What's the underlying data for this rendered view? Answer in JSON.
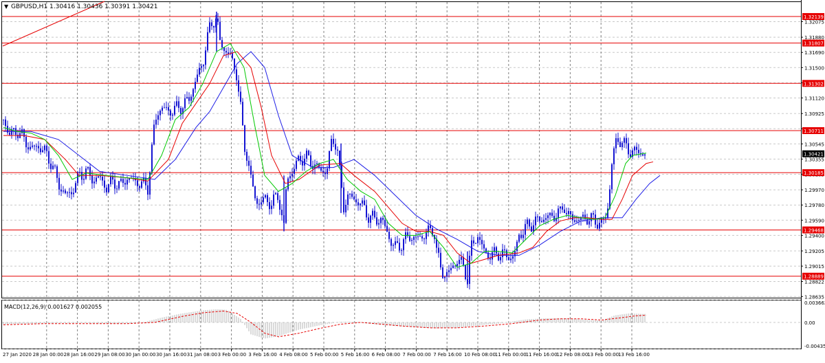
{
  "header": {
    "menu_arrow": "▼",
    "symbol_line": "GBPUSD,H1  1.30416 1.30436 1.30391 1.30421"
  },
  "colors": {
    "background": "#ffffff",
    "grid": "#c8c8c8",
    "candle": "#1414d2",
    "ma_fast": "#00c800",
    "ma_mid": "#e60000",
    "ma_slow": "#1e1ee6",
    "level_line": "#e60000",
    "level_label_bg": "#e60000",
    "current_label_bg": "#000000",
    "macd_hist": "#b4b4b4",
    "macd_signal": "#e60000"
  },
  "price_axis": {
    "ticks": [
      "1.32075",
      "1.31880",
      "1.31690",
      "1.31500",
      "1.31310",
      "1.31120",
      "1.30925",
      "1.30735",
      "1.30545",
      "1.30355",
      "1.30165",
      "1.29970",
      "1.29780",
      "1.29590",
      "1.29400",
      "1.29205",
      "1.29015",
      "1.28822",
      "1.28635"
    ],
    "price_range": [
      1.2862,
      1.3232
    ]
  },
  "levels": [
    "1.32139",
    "1.31807",
    "1.31302",
    "1.30711",
    "1.30185",
    "1.29468",
    "1.28889"
  ],
  "current_price": "1.30421",
  "macd": {
    "title": "MACD(12,26,9) 0.001627 0.002055",
    "ticks": [
      "0.003662",
      "0.00",
      "-0.004358"
    ],
    "value_range": [
      -0.004358,
      0.003662
    ]
  },
  "time_axis": [
    "27 Jan 2020",
    "28 Jan 00:00",
    "28 Jan 16:00",
    "29 Jan 08:00",
    "30 Jan 00:00",
    "30 Jan 16:00",
    "31 Jan 08:00",
    "3 Feb 00:00",
    "3 Feb 16:00",
    "4 Feb 08:00",
    "5 Feb 00:00",
    "5 Feb 16:00",
    "6 Feb 08:00",
    "7 Feb 00:00",
    "7 Feb 16:00",
    "10 Feb 08:00",
    "11 Feb 00:00",
    "11 Feb 16:00",
    "12 Feb 08:00",
    "13 Feb 00:00",
    "13 Feb 16:00"
  ],
  "chart_data": {
    "type": "candlestick",
    "symbol": "GBPUSD",
    "timeframe": "H1",
    "close_path": [
      [
        0,
        1.3085
      ],
      [
        10,
        1.3065
      ],
      [
        20,
        1.3072
      ],
      [
        30,
        1.306
      ],
      [
        40,
        1.3048
      ],
      [
        50,
        1.3052
      ],
      [
        60,
        1.3045
      ],
      [
        70,
        1.303
      ],
      [
        80,
        1.3005
      ],
      [
        90,
        1.299
      ],
      [
        100,
        1.2995
      ],
      [
        110,
        1.3015
      ],
      [
        120,
        1.302
      ],
      [
        130,
        1.301
      ],
      [
        140,
        1.3012
      ],
      [
        150,
        1.3
      ],
      [
        160,
        1.3008
      ],
      [
        170,
        1.3002
      ],
      [
        180,
        1.3012
      ],
      [
        190,
        1.3008
      ],
      [
        200,
        1.3005
      ],
      [
        210,
        1.3
      ],
      [
        215,
        1.304
      ],
      [
        220,
        1.308
      ],
      [
        225,
        1.3095
      ],
      [
        230,
        1.31
      ],
      [
        240,
        1.3095
      ],
      [
        250,
        1.3098
      ],
      [
        260,
        1.3102
      ],
      [
        270,
        1.311
      ],
      [
        280,
        1.3135
      ],
      [
        285,
        1.3145
      ],
      [
        290,
        1.3155
      ],
      [
        295,
        1.3182
      ],
      [
        300,
        1.3198
      ],
      [
        305,
        1.3208
      ],
      [
        310,
        1.3215
      ],
      [
        315,
        1.318
      ],
      [
        320,
        1.3175
      ],
      [
        325,
        1.317
      ],
      [
        330,
        1.3165
      ],
      [
        335,
        1.315
      ],
      [
        340,
        1.314
      ],
      [
        345,
        1.31
      ],
      [
        350,
        1.305
      ],
      [
        355,
        1.304
      ],
      [
        360,
        1.301
      ],
      [
        365,
        1.299
      ],
      [
        370,
        1.298
      ],
      [
        380,
        1.2985
      ],
      [
        390,
        1.298
      ],
      [
        400,
        1.299
      ],
      [
        408,
        1.295
      ],
      [
        412,
        1.301
      ],
      [
        420,
        1.302
      ],
      [
        430,
        1.3035
      ],
      [
        440,
        1.3038
      ],
      [
        450,
        1.303
      ],
      [
        460,
        1.3022
      ],
      [
        470,
        1.302
      ],
      [
        478,
        1.306
      ],
      [
        485,
        1.3055
      ],
      [
        490,
        1.301
      ],
      [
        495,
        1.2975
      ],
      [
        500,
        1.299
      ],
      [
        510,
        1.2985
      ],
      [
        520,
        1.298
      ],
      [
        530,
        1.2965
      ],
      [
        540,
        1.296
      ],
      [
        550,
        1.296
      ],
      [
        560,
        1.294
      ],
      [
        565,
        1.293
      ],
      [
        570,
        1.2925
      ],
      [
        580,
        1.293
      ],
      [
        590,
        1.294
      ],
      [
        600,
        1.2935
      ],
      [
        610,
        1.294
      ],
      [
        620,
        1.2945
      ],
      [
        626,
        1.295
      ],
      [
        630,
        1.292
      ],
      [
        636,
        1.29
      ],
      [
        640,
        1.289
      ],
      [
        650,
        1.2895
      ],
      [
        660,
        1.291
      ],
      [
        670,
        1.29
      ],
      [
        675,
        1.2885
      ],
      [
        680,
        1.2925
      ],
      [
        690,
        1.294
      ],
      [
        700,
        1.2918
      ],
      [
        710,
        1.2915
      ],
      [
        720,
        1.2918
      ],
      [
        730,
        1.2915
      ],
      [
        740,
        1.2912
      ],
      [
        745,
        1.292
      ],
      [
        750,
        1.294
      ],
      [
        760,
        1.295
      ],
      [
        770,
        1.2955
      ],
      [
        780,
        1.296
      ],
      [
        790,
        1.2962
      ],
      [
        800,
        1.2965
      ],
      [
        810,
        1.2968
      ],
      [
        815,
        1.298
      ],
      [
        820,
        1.2965
      ],
      [
        830,
        1.296
      ],
      [
        840,
        1.296
      ],
      [
        850,
        1.2962
      ],
      [
        860,
        1.2958
      ],
      [
        870,
        1.2955
      ],
      [
        875,
        1.296
      ],
      [
        880,
        1.298
      ],
      [
        885,
        1.303
      ],
      [
        890,
        1.3055
      ],
      [
        895,
        1.306
      ],
      [
        900,
        1.3058
      ],
      [
        905,
        1.305
      ],
      [
        910,
        1.3046
      ],
      [
        920,
        1.3045
      ],
      [
        930,
        1.3043
      ],
      [
        935,
        1.3042
      ]
    ],
    "ma_fast": [
      [
        0,
        1.3075
      ],
      [
        20,
        1.307
      ],
      [
        40,
        1.3068
      ],
      [
        60,
        1.306
      ],
      [
        80,
        1.304
      ],
      [
        100,
        1.301
      ],
      [
        120,
        1.3018
      ],
      [
        150,
        1.3015
      ],
      [
        180,
        1.3012
      ],
      [
        210,
        1.301
      ],
      [
        230,
        1.304
      ],
      [
        250,
        1.3085
      ],
      [
        270,
        1.31
      ],
      [
        290,
        1.313
      ],
      [
        310,
        1.317
      ],
      [
        330,
        1.318
      ],
      [
        350,
        1.315
      ],
      [
        365,
        1.308
      ],
      [
        380,
        1.3015
      ],
      [
        400,
        1.2995
      ],
      [
        420,
        1.3005
      ],
      [
        440,
        1.302
      ],
      [
        460,
        1.303
      ],
      [
        480,
        1.3035
      ],
      [
        500,
        1.301
      ],
      [
        520,
        1.2995
      ],
      [
        540,
        1.2985
      ],
      [
        560,
        1.2955
      ],
      [
        580,
        1.294
      ],
      [
        600,
        1.294
      ],
      [
        620,
        1.2945
      ],
      [
        640,
        1.2925
      ],
      [
        660,
        1.29
      ],
      [
        680,
        1.2905
      ],
      [
        700,
        1.292
      ],
      [
        720,
        1.292
      ],
      [
        740,
        1.2918
      ],
      [
        760,
        1.2935
      ],
      [
        780,
        1.2952
      ],
      [
        800,
        1.296
      ],
      [
        820,
        1.2965
      ],
      [
        840,
        1.2962
      ],
      [
        860,
        1.296
      ],
      [
        875,
        1.2962
      ],
      [
        890,
        1.299
      ],
      [
        905,
        1.303
      ],
      [
        915,
        1.304
      ],
      [
        935,
        1.3043
      ]
    ],
    "ma_mid": [
      [
        0,
        1.3065
      ],
      [
        30,
        1.3065
      ],
      [
        60,
        1.306
      ],
      [
        90,
        1.3035
      ],
      [
        110,
        1.3015
      ],
      [
        140,
        1.3015
      ],
      [
        180,
        1.3012
      ],
      [
        210,
        1.3008
      ],
      [
        240,
        1.3035
      ],
      [
        260,
        1.308
      ],
      [
        280,
        1.3105
      ],
      [
        300,
        1.313
      ],
      [
        320,
        1.3165
      ],
      [
        340,
        1.317
      ],
      [
        360,
        1.315
      ],
      [
        375,
        1.31
      ],
      [
        390,
        1.304
      ],
      [
        410,
        1.3005
      ],
      [
        430,
        1.301
      ],
      [
        460,
        1.3028
      ],
      [
        490,
        1.303
      ],
      [
        510,
        1.3015
      ],
      [
        540,
        1.2995
      ],
      [
        560,
        1.2975
      ],
      [
        580,
        1.2955
      ],
      [
        600,
        1.2945
      ],
      [
        620,
        1.2945
      ],
      [
        640,
        1.294
      ],
      [
        660,
        1.2918
      ],
      [
        680,
        1.2905
      ],
      [
        700,
        1.291
      ],
      [
        720,
        1.2915
      ],
      [
        750,
        1.2918
      ],
      [
        770,
        1.2925
      ],
      [
        790,
        1.2945
      ],
      [
        810,
        1.2958
      ],
      [
        830,
        1.2962
      ],
      [
        850,
        1.2962
      ],
      [
        870,
        1.296
      ],
      [
        885,
        1.296
      ],
      [
        900,
        1.2985
      ],
      [
        915,
        1.3015
      ],
      [
        935,
        1.303
      ],
      [
        945,
        1.3032
      ]
    ],
    "ma_slow": [
      [
        0,
        1.307
      ],
      [
        40,
        1.307
      ],
      [
        80,
        1.306
      ],
      [
        110,
        1.304
      ],
      [
        140,
        1.302
      ],
      [
        180,
        1.3015
      ],
      [
        220,
        1.301
      ],
      [
        250,
        1.3035
      ],
      [
        280,
        1.3075
      ],
      [
        300,
        1.3095
      ],
      [
        320,
        1.3125
      ],
      [
        340,
        1.3155
      ],
      [
        360,
        1.317
      ],
      [
        380,
        1.315
      ],
      [
        400,
        1.309
      ],
      [
        420,
        1.304
      ],
      [
        450,
        1.3025
      ],
      [
        480,
        1.3025
      ],
      [
        510,
        1.3035
      ],
      [
        540,
        1.3015
      ],
      [
        570,
        1.299
      ],
      [
        600,
        1.2965
      ],
      [
        630,
        1.2948
      ],
      [
        660,
        1.2935
      ],
      [
        690,
        1.292
      ],
      [
        720,
        1.2915
      ],
      [
        750,
        1.2915
      ],
      [
        780,
        1.2928
      ],
      [
        810,
        1.2945
      ],
      [
        840,
        1.2958
      ],
      [
        870,
        1.2962
      ],
      [
        900,
        1.2962
      ],
      [
        920,
        1.2985
      ],
      [
        940,
        1.3005
      ],
      [
        955,
        1.3015
      ]
    ],
    "macd_hist_path": [
      [
        0,
        -0.0003
      ],
      [
        40,
        -0.0002
      ],
      [
        80,
        -0.0001
      ],
      [
        120,
        -0.0001
      ],
      [
        160,
        -0.0002
      ],
      [
        200,
        -0.0001
      ],
      [
        230,
        0.0008
      ],
      [
        260,
        0.0015
      ],
      [
        290,
        0.002
      ],
      [
        310,
        0.0022
      ],
      [
        325,
        0.0021
      ],
      [
        345,
        0.0006
      ],
      [
        360,
        -0.002
      ],
      [
        380,
        -0.0027
      ],
      [
        400,
        -0.0023
      ],
      [
        430,
        -0.0012
      ],
      [
        460,
        -0.0005
      ],
      [
        490,
        0.0001
      ],
      [
        510,
        0.0001
      ],
      [
        540,
        -0.0003
      ],
      [
        570,
        -0.0006
      ],
      [
        600,
        -0.0008
      ],
      [
        630,
        -0.001
      ],
      [
        660,
        -0.0009
      ],
      [
        690,
        -0.0005
      ],
      [
        720,
        -0.0002
      ],
      [
        760,
        0.0005
      ],
      [
        790,
        0.0007
      ],
      [
        820,
        0.0007
      ],
      [
        850,
        0.0004
      ],
      [
        870,
        0.0003
      ],
      [
        890,
        0.0012
      ],
      [
        910,
        0.0015
      ],
      [
        935,
        0.0014
      ]
    ],
    "macd_signal_path": [
      [
        0,
        -0.0004
      ],
      [
        60,
        -0.0002
      ],
      [
        120,
        -0.0002
      ],
      [
        180,
        -0.0002
      ],
      [
        220,
        0.0
      ],
      [
        260,
        0.001
      ],
      [
        290,
        0.0016
      ],
      [
        320,
        0.0019
      ],
      [
        340,
        0.0015
      ],
      [
        360,
        0.0
      ],
      [
        380,
        -0.0018
      ],
      [
        400,
        -0.0024
      ],
      [
        430,
        -0.0018
      ],
      [
        460,
        -0.001
      ],
      [
        490,
        -0.0003
      ],
      [
        520,
        0.0
      ],
      [
        550,
        -0.0003
      ],
      [
        580,
        -0.0006
      ],
      [
        620,
        -0.0009
      ],
      [
        660,
        -0.0009
      ],
      [
        700,
        -0.0006
      ],
      [
        740,
        -0.0002
      ],
      [
        780,
        0.0004
      ],
      [
        810,
        0.0006
      ],
      [
        840,
        0.0006
      ],
      [
        870,
        0.0004
      ],
      [
        900,
        0.0008
      ],
      [
        920,
        0.0011
      ],
      [
        935,
        0.0012
      ]
    ]
  }
}
